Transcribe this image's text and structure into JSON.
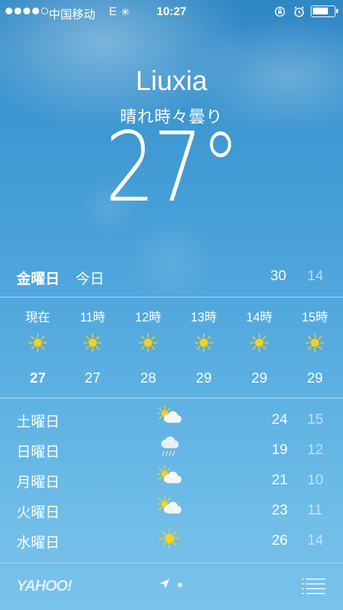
{
  "status_bar": {
    "carrier": "中国移动",
    "network": "E",
    "time": "10:27",
    "signal_dots_filled": 4,
    "signal_dots_total": 5
  },
  "weather": {
    "city": "Liuxia",
    "condition": "晴れ時々曇り",
    "temperature": "27°"
  },
  "today": {
    "day": "金曜日",
    "label": "今日",
    "high": "30",
    "low": "14"
  },
  "hourly": [
    {
      "label": "現在",
      "icon": "sun-icon",
      "temp": "27"
    },
    {
      "label": "11時",
      "icon": "sun-icon",
      "temp": "27"
    },
    {
      "label": "12時",
      "icon": "sun-icon",
      "temp": "28"
    },
    {
      "label": "13時",
      "icon": "sun-icon",
      "temp": "29"
    },
    {
      "label": "14時",
      "icon": "sun-icon",
      "temp": "29"
    },
    {
      "label": "15時",
      "icon": "sun-icon",
      "temp": "29"
    }
  ],
  "daily": [
    {
      "day": "土曜日",
      "icon": "partly-cloudy-icon",
      "high": "24",
      "low": "15"
    },
    {
      "day": "日曜日",
      "icon": "rain-cloud-icon",
      "high": "19",
      "low": "12"
    },
    {
      "day": "月曜日",
      "icon": "partly-cloudy-icon",
      "high": "21",
      "low": "10"
    },
    {
      "day": "火曜日",
      "icon": "partly-cloudy-icon",
      "high": "23",
      "low": "11"
    },
    {
      "day": "水曜日",
      "icon": "sun-icon",
      "high": "26",
      "low": "14"
    }
  ],
  "footer": {
    "brand": "YAHOO!"
  },
  "colors": {
    "sky_top": "#2f87c4",
    "sky_bottom": "#7ac2ea",
    "sun": "#f7d21a"
  }
}
